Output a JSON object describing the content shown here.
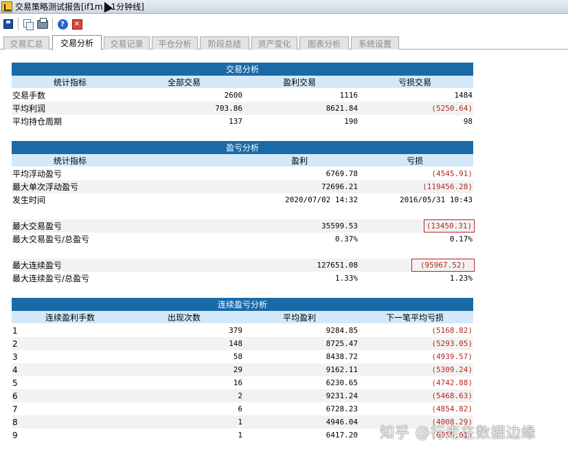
{
  "window": {
    "title": "交易策略测试报告[if1m - 1分钟线]"
  },
  "toolbar": [
    {
      "name": "save-icon"
    },
    {
      "name": "copy-icon"
    },
    {
      "name": "print-icon"
    },
    {
      "name": "help-icon",
      "glyph": "?"
    },
    {
      "name": "close-icon",
      "glyph": "✕"
    }
  ],
  "tabs": [
    {
      "label": "交易汇总"
    },
    {
      "label": "交易分析"
    },
    {
      "label": "交易记录"
    },
    {
      "label": "平仓分析"
    },
    {
      "label": "阶段总结"
    },
    {
      "label": "资产变化"
    },
    {
      "label": "图表分析"
    },
    {
      "label": "系统设置"
    }
  ],
  "trade_analysis": {
    "title": "交易分析",
    "headers": [
      "统计指标",
      "全部交易",
      "盈利交易",
      "亏损交易"
    ],
    "rows": [
      {
        "label": "交易手数",
        "all": "2600",
        "win": "1116",
        "loss": "1484"
      },
      {
        "label": "平均利润",
        "all": "703.86",
        "win": "8621.84",
        "loss": "(5250.64)"
      },
      {
        "label": "平均持仓周期",
        "all": "137",
        "win": "190",
        "loss": "98"
      }
    ]
  },
  "pnl_analysis": {
    "title": "盈亏分析",
    "headers": [
      "统计指标",
      "盈利",
      "亏损"
    ],
    "rows": [
      {
        "label": "平均浮动盈亏",
        "profit": "6769.78",
        "loss": "(4545.91)"
      },
      {
        "label": "最大单次浮动盈亏",
        "profit": "72696.21",
        "loss": "(119456.28)"
      },
      {
        "label": "发生时间",
        "profit": "2020/07/02 14:32",
        "loss": "2016/05/31 10:43"
      },
      {
        "label": "最大交易盈亏",
        "profit": "35599.53",
        "loss": "(13450.31)"
      },
      {
        "label": "最大交易盈亏/总盈亏",
        "profit": "0.37%",
        "loss": "0.17%"
      },
      {
        "label": "最大连续盈亏",
        "profit": "127651.08",
        "loss": "(95967.52)"
      },
      {
        "label": "最大连续盈亏/总盈亏",
        "profit": "1.33%",
        "loss": "1.23%"
      }
    ]
  },
  "streak_analysis": {
    "title": "连续盈亏分析",
    "headers": [
      "连续盈利手数",
      "出现次数",
      "平均盈利",
      "下一笔平均亏损"
    ],
    "rows": [
      {
        "n": "1",
        "count": "379",
        "avg": "9284.85",
        "next": "(5168.82)"
      },
      {
        "n": "2",
        "count": "148",
        "avg": "8725.47",
        "next": "(5293.05)"
      },
      {
        "n": "3",
        "count": "58",
        "avg": "8438.72",
        "next": "(4939.57)"
      },
      {
        "n": "4",
        "count": "29",
        "avg": "9162.11",
        "next": "(5309.24)"
      },
      {
        "n": "5",
        "count": "16",
        "avg": "6230.65",
        "next": "(4742.88)"
      },
      {
        "n": "6",
        "count": "2",
        "avg": "9231.24",
        "next": "(5468.63)"
      },
      {
        "n": "7",
        "count": "6",
        "avg": "6728.23",
        "next": "(4854.82)"
      },
      {
        "n": "8",
        "count": "1",
        "avg": "4946.04",
        "next": "(4008.29)"
      },
      {
        "n": "9",
        "count": "1",
        "avg": "6417.20",
        "next": "(6055.01)"
      }
    ]
  },
  "watermark": "知乎 @行走在数据边缘"
}
